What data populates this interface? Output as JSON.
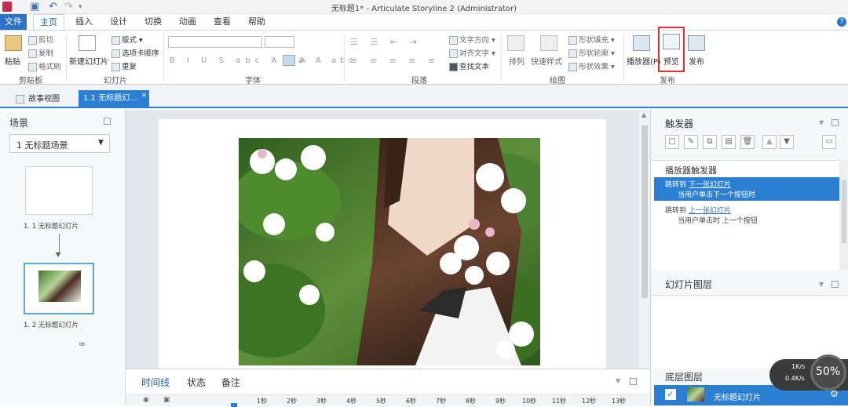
{
  "window": {
    "title": "无标题1* - Articulate Storyline 2 (Administrator)"
  },
  "menubar": {
    "file": "文件",
    "home": "主页",
    "insert": "插入",
    "design": "设计",
    "transitions": "切换",
    "animations": "动画",
    "view": "查看",
    "help": "帮助"
  },
  "ribbon": {
    "clipboard": {
      "label": "剪贴板",
      "paste": "粘贴",
      "cut": "剪切",
      "copy": "复制",
      "format": "格式刷"
    },
    "slides": {
      "label": "幻灯片",
      "new_slide": "新建幻灯片",
      "layout": "版式",
      "tab_order": "选项卡顺序",
      "duplicate": "重复"
    },
    "font": {
      "label": "字体"
    },
    "paragraph": {
      "label": "段落",
      "text_direction": "文字方向",
      "align_text": "对齐文字",
      "find_text": "查找文本"
    },
    "drawing": {
      "label": "绘图",
      "arrange": "排列",
      "quick_styles": "快速样式",
      "shape_fill": "形状填充",
      "shape_outline": "形状轮廓",
      "shape_effects": "形状效果"
    },
    "publish": {
      "label": "发布",
      "player": "播放器(P)",
      "preview": "预览",
      "publish": "发布"
    }
  },
  "doctabs": {
    "story_view": "故事视图",
    "slide_tab": "1.1 无标题幻..."
  },
  "scenes": {
    "title": "场景",
    "selected_scene": "1 无标题场景",
    "slide1_label": "1. 1 无标题幻灯片",
    "slide2_label": "1. 2 无标题幻灯片"
  },
  "timeline": {
    "tabs": [
      "时间线",
      "状态",
      "备注"
    ],
    "ticks": [
      "1秒",
      "2秒",
      "3秒",
      "4秒",
      "5秒",
      "6秒",
      "7秒",
      "8秒",
      "9秒",
      "10秒",
      "11秒",
      "12秒",
      "13秒"
    ]
  },
  "triggers": {
    "title": "触发器",
    "player_triggers": "播放器触发器",
    "items": [
      {
        "action": "跳转到",
        "target": "下一张幻灯片",
        "condition": "当用户单击下一个按钮时"
      },
      {
        "action": "跳转到",
        "target": "上一张幻灯片",
        "condition": "当用户单击时 上一个按钮"
      }
    ]
  },
  "layers": {
    "slide_layers": "幻灯片图层",
    "base_layer": "底层图层",
    "base_layer_item": "无标题幻灯片"
  },
  "speed": {
    "percent": "50%",
    "up": "1K/s",
    "down": "0.4K/s"
  },
  "colors": {
    "accent": "#2b7fd3",
    "highlight": "#e03030"
  }
}
